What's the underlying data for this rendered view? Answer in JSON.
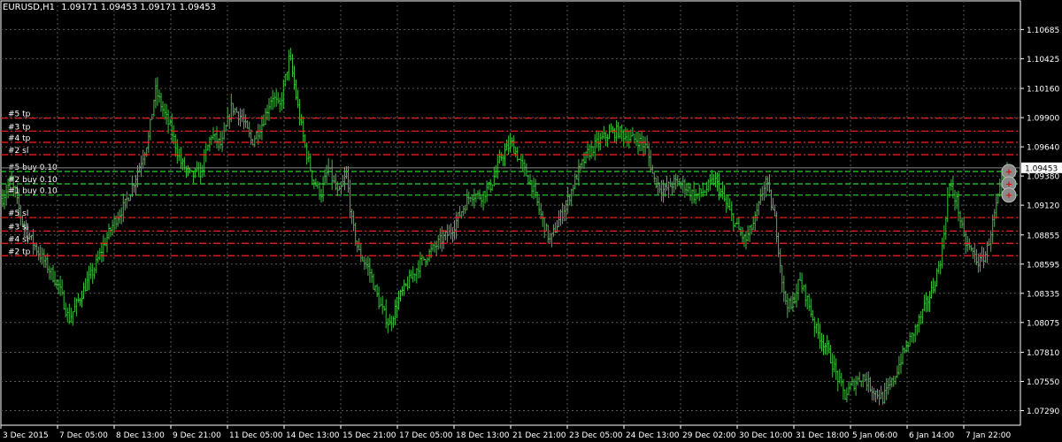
{
  "window": {
    "symbol_timeframe": "EURUSD,H1",
    "ohlc": "1.09171 1.09453 1.09171 1.09453"
  },
  "colors": {
    "background": "#000000",
    "grid": "#5a5a5a",
    "bars": "#3dbf3d",
    "axis_text": "#ffffff",
    "level_red": "#ff1e1e",
    "level_green": "#28d428",
    "bid_label_bg": "#ffffff"
  },
  "chart_data": {
    "type": "bar",
    "title": "",
    "grid": true,
    "ylim": [
      1.0716,
      1.1094
    ],
    "y_ticks": [
      "1.10685",
      "1.10425",
      "1.10160",
      "1.09900",
      "1.09640",
      "1.09380",
      "1.09120",
      "1.08855",
      "1.08595",
      "1.08335",
      "1.08075",
      "1.07810",
      "1.07550",
      "1.07290"
    ],
    "y_tick_values": [
      1.10685,
      1.10425,
      1.1016,
      1.099,
      1.0964,
      1.0938,
      1.0912,
      1.08855,
      1.08595,
      1.08335,
      1.08075,
      1.0781,
      1.0755,
      1.0729
    ],
    "x_ticks": [
      "3 Dec 2015",
      "7 Dec 05:00",
      "8 Dec 13:00",
      "9 Dec 21:00",
      "11 Dec 05:00",
      "14 Dec 13:00",
      "15 Dec 21:00",
      "17 Dec 05:00",
      "18 Dec 13:00",
      "21 Dec 21:00",
      "23 Dec 05:00",
      "24 Dec 13:00",
      "29 Dec 02:00",
      "30 Dec 10:00",
      "31 Dec 18:00",
      "5 Jan 06:00",
      "6 Jan 14:00",
      "7 Jan 22:00"
    ],
    "current_price": "1.09453",
    "price_path": [
      [
        0,
        1.0918
      ],
      [
        0.8,
        1.0935
      ],
      [
        2,
        1.0895
      ],
      [
        3,
        1.0878
      ],
      [
        4.5,
        1.0856
      ],
      [
        5.5,
        1.084
      ],
      [
        6.5,
        1.081
      ],
      [
        7.5,
        1.0828
      ],
      [
        8.3,
        1.0843
      ],
      [
        9,
        1.0855
      ],
      [
        10,
        1.0878
      ],
      [
        11,
        1.0898
      ],
      [
        12,
        1.0912
      ],
      [
        13,
        1.0935
      ],
      [
        14.3,
        1.097
      ],
      [
        15,
        1.1015
      ],
      [
        15.7,
        1.0998
      ],
      [
        16.5,
        1.098
      ],
      [
        17.5,
        1.095
      ],
      [
        18.5,
        1.0938
      ],
      [
        19.5,
        1.0942
      ],
      [
        20.5,
        1.0975
      ],
      [
        21.5,
        1.0965
      ],
      [
        22.5,
        1.1
      ],
      [
        23.5,
        1.099
      ],
      [
        24.5,
        1.0968
      ],
      [
        25.5,
        1.0985
      ],
      [
        26.5,
        1.101
      ],
      [
        27.2,
        1.0998
      ],
      [
        28.2,
        1.1045
      ],
      [
        29,
        1.1
      ],
      [
        29.7,
        1.0965
      ],
      [
        30.5,
        1.0935
      ],
      [
        31.3,
        1.0922
      ],
      [
        32,
        1.0945
      ],
      [
        33,
        1.092
      ],
      [
        33.8,
        1.094
      ],
      [
        34.3,
        1.0898
      ],
      [
        35,
        1.087
      ],
      [
        36,
        1.0855
      ],
      [
        37,
        1.0825
      ],
      [
        38,
        1.0805
      ],
      [
        39,
        1.083
      ],
      [
        40,
        1.0845
      ],
      [
        41,
        1.086
      ],
      [
        42,
        1.087
      ],
      [
        43,
        1.088
      ],
      [
        44,
        1.0888
      ],
      [
        45,
        1.0905
      ],
      [
        46,
        1.0922
      ],
      [
        47,
        1.092
      ],
      [
        48,
        1.093
      ],
      [
        49,
        1.0955
      ],
      [
        50,
        1.0968
      ],
      [
        51,
        1.0948
      ],
      [
        52,
        1.093
      ],
      [
        53,
        1.09
      ],
      [
        53.8,
        1.088
      ],
      [
        54.5,
        1.0895
      ],
      [
        55.5,
        1.0915
      ],
      [
        56.5,
        1.094
      ],
      [
        57.5,
        1.0958
      ],
      [
        58.5,
        1.0968
      ],
      [
        59.5,
        1.0975
      ],
      [
        60.5,
        1.0978
      ],
      [
        61.5,
        1.0972
      ],
      [
        62.5,
        1.097
      ],
      [
        63.3,
        1.0963
      ],
      [
        64,
        1.0935
      ],
      [
        65,
        1.0925
      ],
      [
        66,
        1.0932
      ],
      [
        67,
        1.093
      ],
      [
        68,
        1.092
      ],
      [
        69,
        1.0925
      ],
      [
        70,
        1.0935
      ],
      [
        71,
        1.0915
      ],
      [
        72,
        1.0895
      ],
      [
        73,
        1.088
      ],
      [
        74,
        1.09
      ],
      [
        75,
        1.0935
      ],
      [
        76,
        1.0895
      ],
      [
        76.8,
        1.083
      ],
      [
        77.5,
        1.082
      ],
      [
        78.3,
        1.0845
      ],
      [
        79,
        1.083
      ],
      [
        80,
        1.08
      ],
      [
        81,
        1.0785
      ],
      [
        82,
        1.076
      ],
      [
        82.8,
        1.0742
      ],
      [
        83.5,
        1.0752
      ],
      [
        84.5,
        1.076
      ],
      [
        85.5,
        1.0748
      ],
      [
        86.5,
        1.074
      ],
      [
        87.5,
        1.0755
      ],
      [
        88.5,
        1.078
      ],
      [
        89.5,
        1.0798
      ],
      [
        90.5,
        1.0818
      ],
      [
        91.5,
        1.084
      ],
      [
        92.3,
        1.0868
      ],
      [
        93,
        1.093
      ],
      [
        93.8,
        1.0915
      ],
      [
        94.5,
        1.088
      ],
      [
        95.3,
        1.087
      ],
      [
        96,
        1.086
      ],
      [
        96.7,
        1.087
      ],
      [
        97.4,
        1.09
      ],
      [
        98.2,
        1.0932
      ],
      [
        98.9,
        1.0945
      ]
    ],
    "horizontal_levels": [
      {
        "label": "#5 tp",
        "price": 1.09895,
        "kind": "red"
      },
      {
        "label": "#3 tp",
        "price": 1.0978,
        "kind": "red"
      },
      {
        "label": "#4 tp",
        "price": 1.0968,
        "kind": "red"
      },
      {
        "label": "#2 sl",
        "price": 1.0957,
        "kind": "red"
      },
      {
        "label": "#5 buy 0.10",
        "price": 1.0942,
        "kind": "green"
      },
      {
        "label": "#2 buy 0.10",
        "price": 1.0931,
        "kind": "green"
      },
      {
        "label": "#1 buy 0.10",
        "price": 1.0921,
        "kind": "green"
      },
      {
        "label": "#5 sl",
        "price": 1.0901,
        "kind": "red"
      },
      {
        "label": "#3 sl",
        "price": 1.0889,
        "kind": "red"
      },
      {
        "label": "#4 sl",
        "price": 1.0878,
        "kind": "red"
      },
      {
        "label": "#2 tp",
        "price": 1.0867,
        "kind": "red"
      }
    ]
  }
}
